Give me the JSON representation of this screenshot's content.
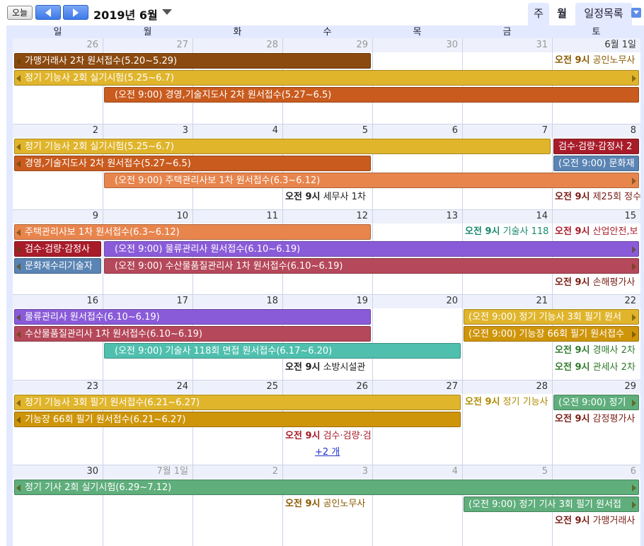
{
  "toolbar": {
    "today_label": "오늘",
    "month_title": "2019년 6월",
    "tab_week": "주",
    "tab_month": "월",
    "tab_list": "일정목록"
  },
  "weekdays": [
    "일",
    "월",
    "화",
    "수",
    "목",
    "금",
    "토"
  ],
  "weeks": [
    {
      "days": [
        "26",
        "27",
        "28",
        "29",
        "30",
        "31",
        "6월 1일"
      ],
      "other": [
        true,
        true,
        true,
        true,
        true,
        true,
        false
      ]
    },
    {
      "days": [
        "2",
        "3",
        "4",
        "5",
        "6",
        "7",
        "8"
      ],
      "other": [
        false,
        false,
        false,
        false,
        false,
        false,
        false
      ]
    },
    {
      "days": [
        "9",
        "10",
        "11",
        "12",
        "13",
        "14",
        "15"
      ],
      "other": [
        false,
        false,
        false,
        false,
        false,
        false,
        false
      ]
    },
    {
      "days": [
        "16",
        "17",
        "18",
        "19",
        "20",
        "21",
        "22"
      ],
      "other": [
        false,
        false,
        false,
        false,
        false,
        false,
        false
      ]
    },
    {
      "days": [
        "23",
        "24",
        "25",
        "26",
        "27",
        "28",
        "29"
      ],
      "other": [
        false,
        false,
        false,
        false,
        false,
        false,
        false
      ]
    },
    {
      "days": [
        "30",
        "7월 1일",
        "2",
        "3",
        "4",
        "5",
        "6"
      ],
      "other": [
        false,
        true,
        true,
        true,
        true,
        true,
        true
      ]
    }
  ],
  "events": [
    {
      "week": 0,
      "row": 0,
      "start": 0,
      "end": 3.99,
      "label": "가맹거래사 2차 원서접수(5.20~5.29)",
      "color": "#8b4a0f",
      "left": true,
      "right": false
    },
    {
      "week": 0,
      "row": 1,
      "start": 0,
      "end": 6.99,
      "label": "정기 기능사 2회 실기시험(5.25~6.7)",
      "color": "#e0b52c",
      "left": true,
      "right": true
    },
    {
      "week": 0,
      "row": 2,
      "start": 1,
      "end": 6.99,
      "label": "(오전 9:00) 경영,기술지도사 2차 원서접수(5.27~6.5)",
      "color": "#c95b1e",
      "left": false,
      "right": false
    },
    {
      "week": 1,
      "row": 0,
      "start": 0,
      "end": 5.99,
      "label": "정기 기능사 2회 실기시험(5.25~6.7)",
      "color": "#e0b52c",
      "left": true,
      "right": false
    },
    {
      "week": 1,
      "row": 1,
      "start": 0,
      "end": 3.99,
      "label": "경영,기술지도사 2차 원서접수(5.27~6.5)",
      "color": "#c95b1e",
      "left": true,
      "right": false
    },
    {
      "week": 1,
      "row": 2,
      "start": 1,
      "end": 6.99,
      "label": "(오전 9:00) 주택관리사보 1차 원서접수(6.3~6.12)",
      "color": "#e8854d",
      "left": false,
      "right": true
    },
    {
      "week": 1,
      "row": 0,
      "start": 6,
      "end": 6.99,
      "label": "검수·검량·감정사 2",
      "color": "#a81c2a",
      "left": false,
      "right": false,
      "nl": true
    },
    {
      "week": 1,
      "row": 1,
      "start": 6,
      "end": 6.99,
      "label": "(오전 9:00) 문화재",
      "color": "#5a84b3",
      "left": false,
      "right": false,
      "nl": true
    },
    {
      "week": 2,
      "row": 0,
      "start": 0,
      "end": 3.99,
      "label": "주택관리사보 1차 원서접수(6.3~6.12)",
      "color": "#e8854d",
      "left": true,
      "right": false
    },
    {
      "week": 2,
      "row": 1,
      "start": 0,
      "end": 0.99,
      "label": "검수·검량·감정사",
      "color": "#a81c2a",
      "left": true,
      "right": false
    },
    {
      "week": 2,
      "row": 1,
      "start": 1,
      "end": 6.99,
      "label": "(오전 9:00) 물류관리사 원서접수(6.10~6.19)",
      "color": "#8a5bd9",
      "left": false,
      "right": true
    },
    {
      "week": 2,
      "row": 2,
      "start": 0,
      "end": 0.99,
      "label": "문화재수리기술자",
      "color": "#5a84b3",
      "left": true,
      "right": false
    },
    {
      "week": 2,
      "row": 2,
      "start": 1,
      "end": 6.99,
      "label": "(오전 9:00) 수산물품질관리사 1차 원서접수(6.10~6.19)",
      "color": "#b5485a",
      "left": false,
      "right": true
    },
    {
      "week": 3,
      "row": 0,
      "start": 0,
      "end": 3.99,
      "label": "물류관리사 원서접수(6.10~6.19)",
      "color": "#8a5bd9",
      "left": true,
      "right": false
    },
    {
      "week": 3,
      "row": 1,
      "start": 0,
      "end": 3.99,
      "label": "수산물품질관리사 1차 원서접수(6.10~6.19)",
      "color": "#b5485a",
      "left": true,
      "right": false
    },
    {
      "week": 3,
      "row": 2,
      "start": 1,
      "end": 4.99,
      "label": "(오전 9:00) 기술사 118회 면접 원서접수(6.17~6.20)",
      "color": "#4fbfae",
      "left": false,
      "right": false
    },
    {
      "week": 3,
      "row": 0,
      "start": 5,
      "end": 6.99,
      "label": "(오전 9:00) 정기 기능사 3회 필기 원서",
      "color": "#e0b52c",
      "left": false,
      "right": true,
      "nl": true
    },
    {
      "week": 3,
      "row": 1,
      "start": 5,
      "end": 6.99,
      "label": "(오전 9:00) 기능장 66회 필기 원서접수",
      "color": "#cf950a",
      "left": false,
      "right": true,
      "nl": true
    },
    {
      "week": 4,
      "row": 0,
      "start": 0,
      "end": 4.99,
      "label": "정기 기능사 3회 필기 원서접수(6.21~6.27)",
      "color": "#e0b52c",
      "left": true,
      "right": false
    },
    {
      "week": 4,
      "row": 1,
      "start": 0,
      "end": 4.99,
      "label": "기능장 66회 필기 원서접수(6.21~6.27)",
      "color": "#cf950a",
      "left": true,
      "right": false
    },
    {
      "week": 4,
      "row": 0,
      "start": 6,
      "end": 6.99,
      "label": "(오전 9:00) 정기",
      "color": "#5fae7c",
      "left": false,
      "right": true,
      "nl": true
    },
    {
      "week": 5,
      "row": 0,
      "start": 0,
      "end": 6.99,
      "label": "정기 기사 2회 실기시험(6.29~7.12)",
      "color": "#5fae7c",
      "left": true,
      "right": true
    },
    {
      "week": 5,
      "row": 1,
      "start": 5,
      "end": 6.99,
      "label": "(오전 9:00) 정기 기사 3회 필기 원서접",
      "color": "#5fae7c",
      "left": false,
      "right": true,
      "nl": true
    }
  ],
  "timed_events": [
    {
      "week": 0,
      "row": 0,
      "day": 6,
      "time": "오전 9시",
      "label": "공인노무사",
      "color": "#8a5a00"
    },
    {
      "week": 1,
      "row": 3,
      "day": 3,
      "time": "오전 9시",
      "label": "세무사 1차",
      "color": "#222222"
    },
    {
      "week": 1,
      "row": 3,
      "day": 6,
      "time": "오전 9시",
      "label": "제25회 정수",
      "color": "#7a1e14"
    },
    {
      "week": 2,
      "row": 0,
      "day": 5,
      "time": "오전 9시",
      "label": "기술사 118",
      "color": "#1a8a70"
    },
    {
      "week": 2,
      "row": 0,
      "day": 6,
      "time": "오전 9시",
      "label": "산업안전,보",
      "color": "#a81c2a"
    },
    {
      "week": 2,
      "row": 3,
      "day": 6,
      "time": "오전 9시",
      "label": "손해평가사",
      "color": "#7a1e14"
    },
    {
      "week": 3,
      "row": 3,
      "day": 3,
      "time": "오전 9시",
      "label": "소방시설관",
      "color": "#222222"
    },
    {
      "week": 3,
      "row": 2,
      "day": 6,
      "time": "오전 9시",
      "label": "경매사 2차",
      "color": "#2f7a2a"
    },
    {
      "week": 3,
      "row": 3,
      "day": 6,
      "time": "오전 9시",
      "label": "관세사 2차",
      "color": "#2f7a2a"
    },
    {
      "week": 4,
      "row": 0,
      "day": 5,
      "time": "오전 9시",
      "label": "정기 기능사",
      "color": "#b08a00"
    },
    {
      "week": 4,
      "row": 2,
      "day": 3,
      "time": "오전 9시",
      "label": "검수·검량·검",
      "color": "#a81c2a"
    },
    {
      "week": 4,
      "row": 1,
      "day": 6,
      "time": "오전 9시",
      "label": "감정평가사",
      "color": "#7a1e14"
    },
    {
      "week": 5,
      "row": 1,
      "day": 3,
      "time": "오전 9시",
      "label": "공인노무사",
      "color": "#8a5a00"
    },
    {
      "week": 5,
      "row": 2,
      "day": 6,
      "time": "오전 9시",
      "label": "가맹거래사",
      "color": "#7a1e14"
    }
  ],
  "more_links": [
    {
      "week": 4,
      "day": 3,
      "label": "+2 개"
    }
  ]
}
